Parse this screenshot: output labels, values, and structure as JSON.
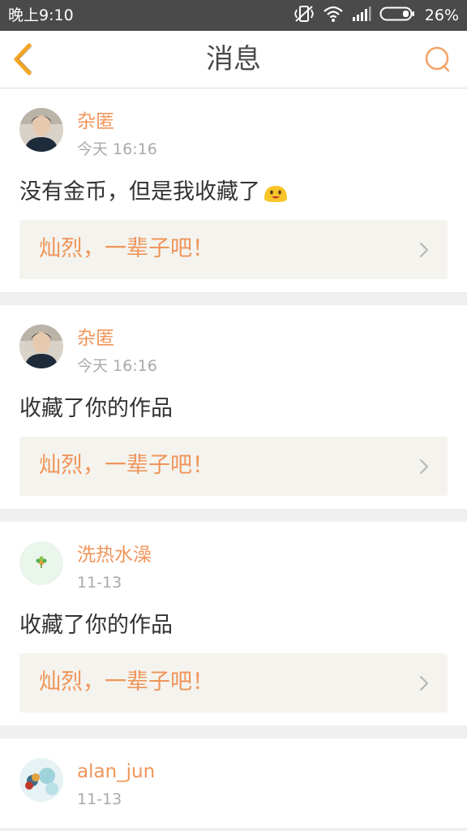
{
  "status_bar": {
    "time": "晚上9:10",
    "battery": "26%",
    "icons": [
      "vibrate-off-icon",
      "wifi-icon",
      "signal-icon",
      "battery-icon"
    ]
  },
  "nav": {
    "title": "消息",
    "back_icon": "chevron-left-icon",
    "search_icon": "search-icon"
  },
  "colors": {
    "accent": "#f0955a",
    "nav_icon": "#f5a623",
    "text": "#333333",
    "muted": "#aaaaaa",
    "status_bar": "#4a4a4a"
  },
  "messages": [
    {
      "user": "杂匿",
      "time": "今天 16:16",
      "text": "没有金币，但是我收藏了",
      "emoji": "smile-emoji",
      "work": "灿烈，一辈子吧！"
    },
    {
      "user": "杂匿",
      "time": "今天 16:16",
      "text": "收藏了你的作品",
      "work": "灿烈，一辈子吧！"
    },
    {
      "user": "洗热水澡",
      "time": "11-13",
      "text": "收藏了你的作品",
      "work": "灿烈，一辈子吧！"
    },
    {
      "user": "alan_jun",
      "time": "11-13"
    }
  ]
}
